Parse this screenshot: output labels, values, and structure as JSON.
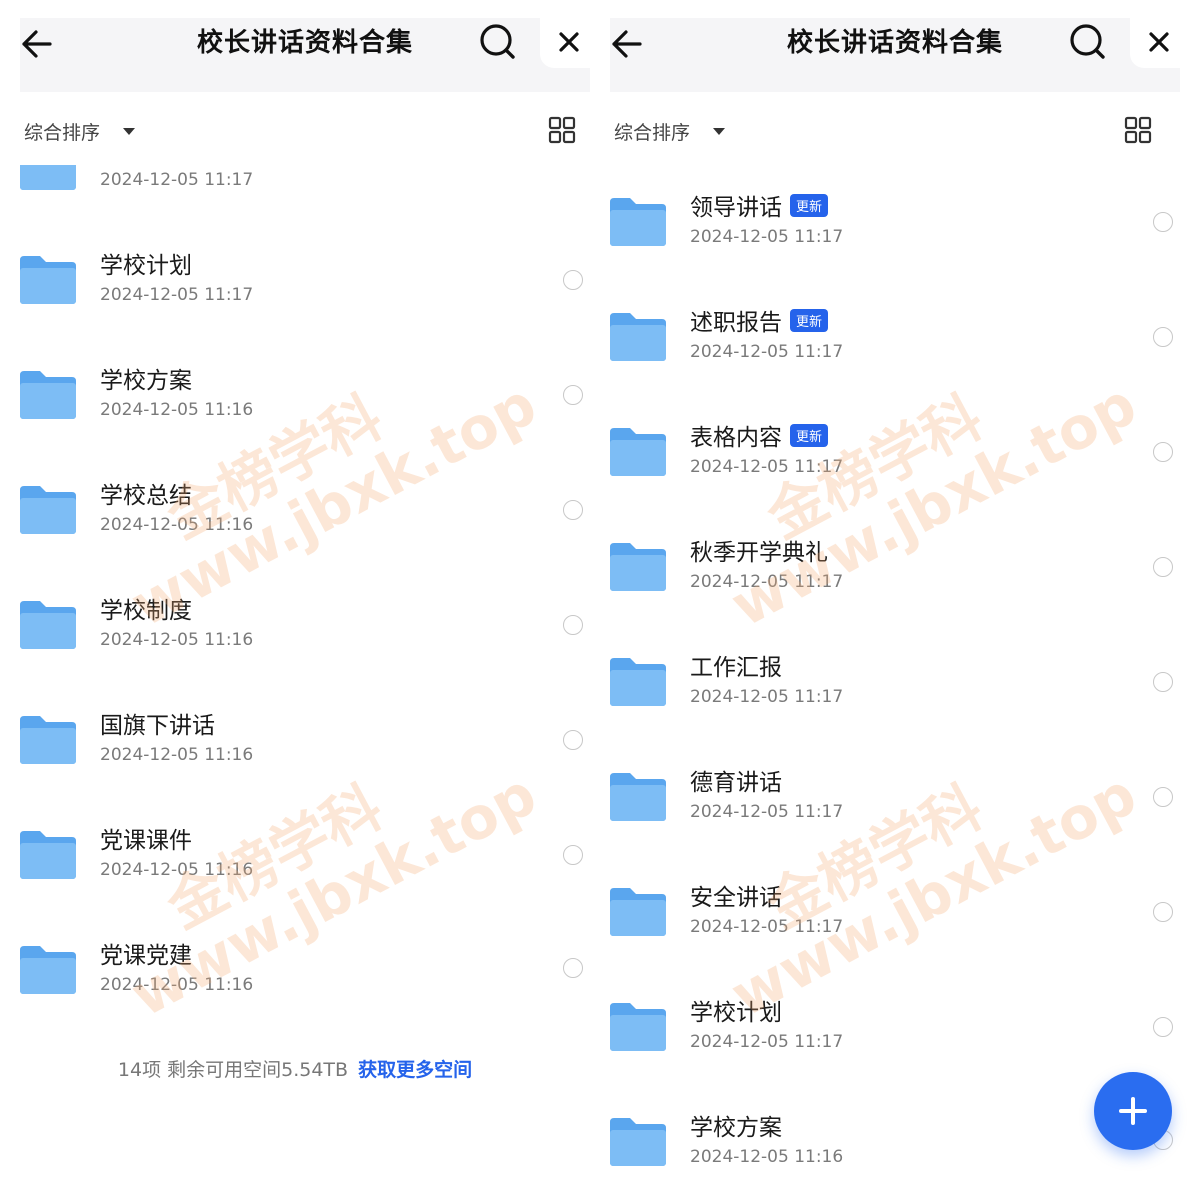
{
  "header": {
    "title": "校长讲话资料合集"
  },
  "sort": {
    "label": "综合排序"
  },
  "left": {
    "items": [
      {
        "name": "",
        "date": "2024-12-05 11:17"
      },
      {
        "name": "学校计划",
        "date": "2024-12-05 11:17"
      },
      {
        "name": "学校方案",
        "date": "2024-12-05 11:16"
      },
      {
        "name": "学校总结",
        "date": "2024-12-05 11:16"
      },
      {
        "name": "学校制度",
        "date": "2024-12-05 11:16"
      },
      {
        "name": "国旗下讲话",
        "date": "2024-12-05 11:16"
      },
      {
        "name": "党课课件",
        "date": "2024-12-05 11:16"
      },
      {
        "name": "党课党建",
        "date": "2024-12-05 11:16"
      }
    ],
    "footer": {
      "summary": "14项 剩余可用空间5.54TB",
      "more_link": "获取更多空间"
    }
  },
  "right": {
    "items": [
      {
        "name": "领导讲话",
        "badge": "更新",
        "date": "2024-12-05 11:17"
      },
      {
        "name": "述职报告",
        "badge": "更新",
        "date": "2024-12-05 11:17"
      },
      {
        "name": "表格内容",
        "badge": "更新",
        "date": "2024-12-05 11:17"
      },
      {
        "name": "秋季开学典礼",
        "date": "2024-12-05 11:17"
      },
      {
        "name": "工作汇报",
        "date": "2024-12-05 11:17"
      },
      {
        "name": "德育讲话",
        "date": "2024-12-05 11:17"
      },
      {
        "name": "安全讲话",
        "date": "2024-12-05 11:17"
      },
      {
        "name": "学校计划",
        "date": "2024-12-05 11:17"
      },
      {
        "name": "学校方案",
        "date": "2024-12-05 11:16"
      }
    ]
  },
  "watermark": {
    "line1": "金榜学科",
    "line2": "www.jbxk.top"
  },
  "colors": {
    "accent": "#2563eb",
    "folder": "#6fb2f2",
    "fab": "#2a6df0"
  },
  "icons": {
    "back": "arrow-left-icon",
    "search": "search-icon",
    "close": "close-icon",
    "view": "grid-view-icon",
    "folder": "folder-icon",
    "add": "plus-icon"
  }
}
